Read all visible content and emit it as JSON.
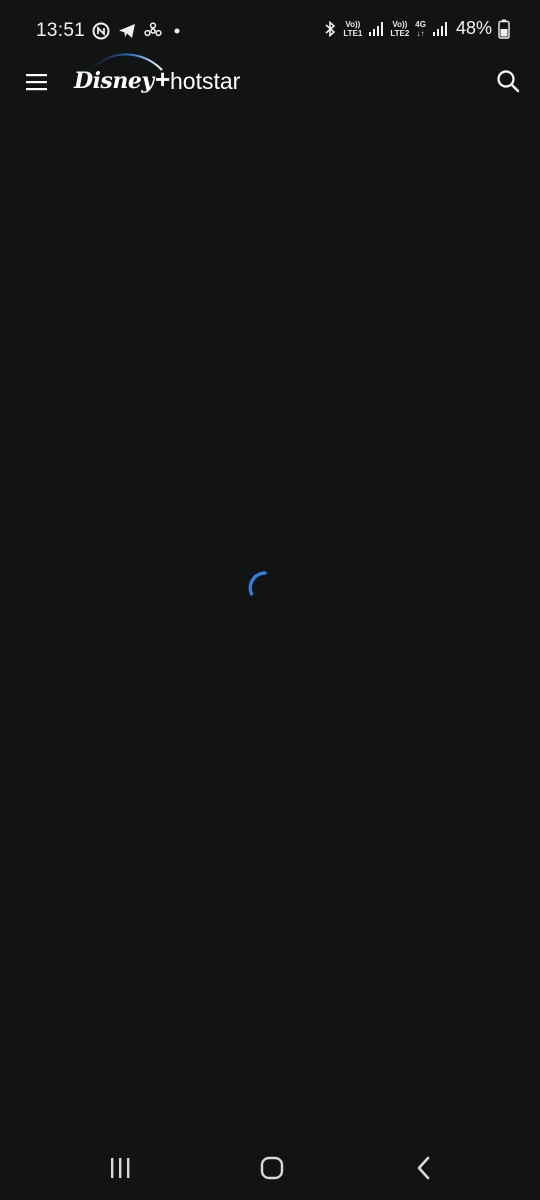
{
  "status_bar": {
    "time": "13:51",
    "notification_icons": [
      "nfc-icon",
      "telegram-icon",
      "fan-icon",
      "dot-icon"
    ],
    "bluetooth_icon": "bluetooth-icon",
    "sim1": {
      "volte": "Vo))",
      "lte": "LTE1"
    },
    "sim2": {
      "volte": "Vo))",
      "lte": "LTE2",
      "network": "4G"
    },
    "battery_percent": "48%"
  },
  "header": {
    "menu_icon": "hamburger-menu-icon",
    "logo_disney": "Disney",
    "logo_plus": "+",
    "logo_hotstar": "hotstar",
    "search_icon": "search-icon"
  },
  "content": {
    "state": "loading",
    "spinner_color": "#2f7fe0"
  },
  "nav_bar": {
    "recents_icon": "recents-icon",
    "home_icon": "home-icon",
    "back_icon": "back-icon"
  },
  "colors": {
    "background": "#121414",
    "foreground": "#ffffff",
    "accent": "#2f7fe0"
  }
}
